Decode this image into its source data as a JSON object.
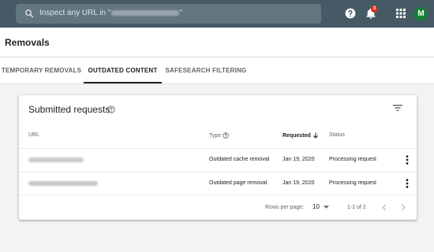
{
  "search": {
    "placeholder": "Inspect any URL in \"",
    "closing_quote": "\"",
    "icon": "search-icon"
  },
  "header": {
    "help_icon": "help-circle-icon",
    "notifications": {
      "icon": "bell-icon",
      "count": "3"
    },
    "apps_icon": "apps-grid-icon",
    "avatar_initial": "M",
    "avatar_color": "#188038"
  },
  "page": {
    "title": "Removals"
  },
  "tabs": [
    {
      "label": "TEMPORARY REMOVALS",
      "active": false
    },
    {
      "label": "OUTDATED CONTENT",
      "active": true
    },
    {
      "label": "SAFESEARCH FILTERING",
      "active": false
    }
  ],
  "card": {
    "title": "Submitted requests",
    "columns": {
      "url": "URL",
      "type": "Type",
      "requested": "Requested",
      "status": "Status"
    },
    "rows": [
      {
        "type": "Outdated cache removal",
        "requested": "Jan 19, 2020",
        "status": "Processing request"
      },
      {
        "type": "Outdated page removal",
        "requested": "Jan 19, 2020",
        "status": "Processing request"
      }
    ],
    "footer": {
      "rows_per_page_label": "Rows per page:",
      "rows_per_page_value": "10",
      "range": "1-2 of 2"
    }
  },
  "colors": {
    "topbar": "#455a64",
    "badge": "#d93025",
    "background": "#f1f3f4"
  }
}
